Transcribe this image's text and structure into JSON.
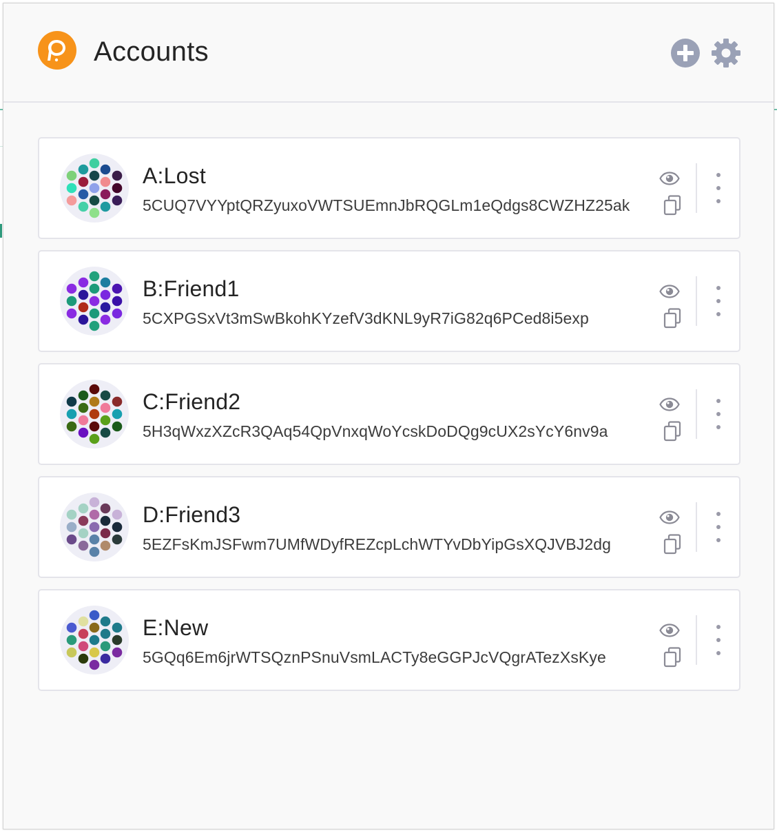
{
  "header": {
    "title": "Accounts",
    "logo_color": "#f7931a",
    "icon_color": "#9aa1b6",
    "icons": [
      "polkadot-logo-icon",
      "add-account-icon",
      "settings-gear-icon"
    ]
  },
  "accounts": [
    {
      "name": "A:Lost",
      "address": "5CUQ7VYYptQRZyuxoVWTSUEmnJbRQGLm1eQdgs8CWZHZ25ak",
      "identicon_colors": [
        "#3fcfa0",
        "#1e9b9d",
        "#1a4a8f",
        "#7ed17a",
        "#17464a",
        "#3b1d48",
        "#9a1c3a",
        "#f08a8e",
        "#2fe0b9",
        "#8fa1ea",
        "#43062a",
        "#285aa6",
        "#8a1a5a",
        "#f49b9b",
        "#174a44",
        "#3a1d58",
        "#45d0a8",
        "#1e9aa0",
        "#8ee08a"
      ]
    },
    {
      "name": "B:Friend1",
      "address": "5CXPGSxVt3mSwBkohKYzefV3dKNL9yR7iG82q6PCed8i5exp",
      "identicon_colors": [
        "#21a17c",
        "#8a2be2",
        "#1c7ea0",
        "#8a2be2",
        "#1c9a7a",
        "#4a14b0",
        "#2b159a",
        "#7a28e0",
        "#1c9a7a",
        "#8a2be2",
        "#3a10a8",
        "#b02a1a",
        "#2a1aa0",
        "#8a2be2",
        "#1c9a7a",
        "#7a28e0",
        "#2b159a",
        "#8a2be2",
        "#21a17c"
      ]
    },
    {
      "name": "C:Friend2",
      "address": "5H3qWxzXZcR3QAq54QpVnxqWoYcskDoDQg9cUX2sYcY6nv9a",
      "identicon_colors": [
        "#5a0a0a",
        "#1a5a1a",
        "#174a44",
        "#103a48",
        "#b07a1a",
        "#8a2a2a",
        "#3a6a14",
        "#f07a9a",
        "#17a0b0",
        "#b03a10",
        "#17a0b0",
        "#f07a9a",
        "#5aa01a",
        "#3a6a14",
        "#5a0a0a",
        "#1a5a1a",
        "#6a10c0",
        "#174a44",
        "#5aa01a"
      ]
    },
    {
      "name": "D:Friend3",
      "address": "5EZFsKmJSFwm7UMfWDyfREZcpLchWTYvDbYipGsXQJVBJ2dg",
      "identicon_colors": [
        "#c8b2d8",
        "#a4d2c4",
        "#6a3a5a",
        "#a4d2c4",
        "#b06aa8",
        "#c8b2d8",
        "#8a3a5a",
        "#1a2a3a",
        "#9aaec8",
        "#8a6ab0",
        "#1a2a3a",
        "#a4d2c4",
        "#7a2a4a",
        "#6a4a8a",
        "#5a82a8",
        "#2a3a3a",
        "#8a6a9a",
        "#b08a6a",
        "#5a82a8"
      ]
    },
    {
      "name": "E:New",
      "address": "5GQq6Em6jrWTSQznPSnuVsmLACTy8eGGPJcVQgrATezXsKye",
      "identicon_colors": [
        "#3a5ac8",
        "#e0e0a0",
        "#1e7a8a",
        "#4a5ad0",
        "#8a6a1a",
        "#1e7a8a",
        "#c8405a",
        "#1e7a8a",
        "#2a9a7a",
        "#1e7a8a",
        "#2a3a2a",
        "#d04a7a",
        "#2a9a7a",
        "#c8c85a",
        "#d8c84a",
        "#7a2aa0",
        "#2a3a0a",
        "#3a2aa0",
        "#7a2aa0"
      ]
    }
  ]
}
